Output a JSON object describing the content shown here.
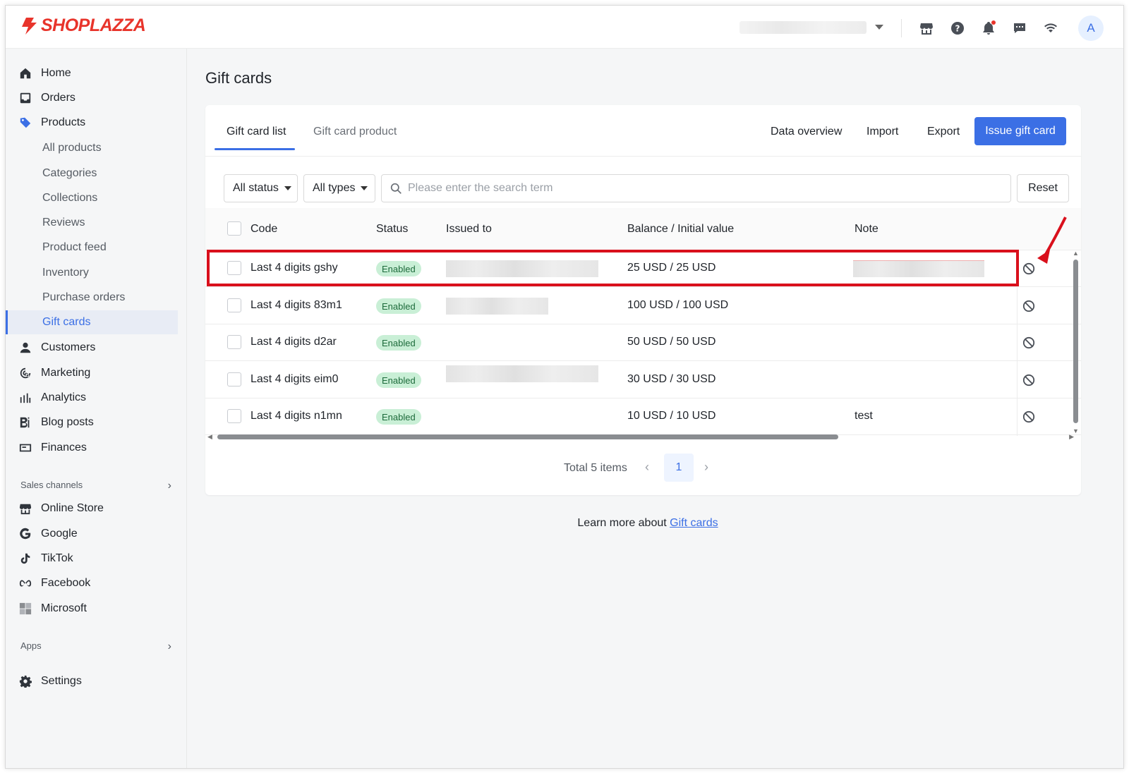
{
  "brand": {
    "name": "SHOPLAZZA",
    "accent": "#3b6fe5",
    "brand_red": "#e8342b"
  },
  "topbar": {
    "icons": [
      "store-icon",
      "help-icon",
      "bell-icon",
      "chat-icon",
      "wifi-icon"
    ],
    "avatar": "A"
  },
  "sidebar": {
    "items": [
      {
        "label": "Home",
        "icon": "home-icon"
      },
      {
        "label": "Orders",
        "icon": "inbox-icon"
      },
      {
        "label": "Products",
        "icon": "tag-icon"
      }
    ],
    "product_sub": [
      "All products",
      "Categories",
      "Collections",
      "Reviews",
      "Product feed",
      "Inventory",
      "Purchase orders",
      "Gift cards"
    ],
    "items2": [
      {
        "label": "Customers",
        "icon": "person-icon"
      },
      {
        "label": "Marketing",
        "icon": "marketing-icon"
      },
      {
        "label": "Analytics",
        "icon": "bar-chart-icon"
      },
      {
        "label": "Blog posts",
        "icon": "blog-icon"
      },
      {
        "label": "Finances",
        "icon": "finance-icon"
      }
    ],
    "sales_channels_label": "Sales channels",
    "channels": [
      {
        "label": "Online Store",
        "icon": "store-icon"
      },
      {
        "label": "Google",
        "icon": "google-icon"
      },
      {
        "label": "TikTok",
        "icon": "tiktok-icon"
      },
      {
        "label": "Facebook",
        "icon": "meta-icon"
      },
      {
        "label": "Microsoft",
        "icon": "microsoft-icon"
      }
    ],
    "apps_label": "Apps",
    "settings_label": "Settings"
  },
  "page": {
    "title": "Gift cards"
  },
  "tabs": [
    "Gift card list",
    "Gift card product"
  ],
  "header_actions": {
    "data_overview": "Data overview",
    "import": "Import",
    "export": "Export",
    "issue": "Issue gift card"
  },
  "filters": {
    "status": "All status",
    "types": "All types",
    "search_placeholder": "Please enter the search term",
    "reset": "Reset"
  },
  "table": {
    "columns": [
      "Code",
      "Status",
      "Issued to",
      "Balance / Initial value",
      "Note"
    ],
    "rows": [
      {
        "code": "Last 4 digits gshy",
        "status": "Enabled",
        "balance": "25 USD / 25 USD",
        "note": ""
      },
      {
        "code": "Last 4 digits 83m1",
        "status": "Enabled",
        "balance": "100 USD / 100 USD",
        "note": ""
      },
      {
        "code": "Last 4 digits d2ar",
        "status": "Enabled",
        "balance": "50 USD / 50 USD",
        "note": ""
      },
      {
        "code": "Last 4 digits eim0",
        "status": "Enabled",
        "balance": "30 USD / 30 USD",
        "note": ""
      },
      {
        "code": "Last 4 digits n1mn",
        "status": "Enabled",
        "balance": "10 USD / 10 USD",
        "note": "test"
      }
    ]
  },
  "pagination": {
    "total": "Total 5 items",
    "current_page": "1"
  },
  "footer": {
    "text": "Learn more about ",
    "link": "Gift cards"
  }
}
